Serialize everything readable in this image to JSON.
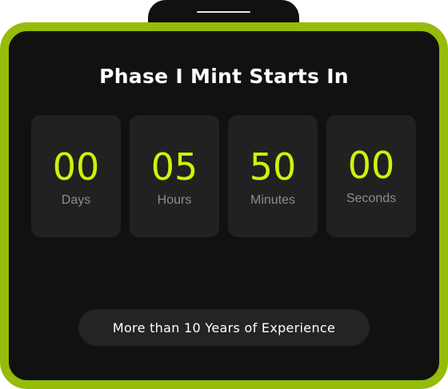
{
  "title": "Phase I Mint Starts In",
  "countdown": [
    {
      "value": "00",
      "label": "Days"
    },
    {
      "value": "05",
      "label": "Hours"
    },
    {
      "value": "50",
      "label": "Minutes"
    },
    {
      "value": "00",
      "label": "Seconds"
    }
  ],
  "experience_label": "More than 10 Years of Experience",
  "colors": {
    "accent": "#d0f20a",
    "frame": "#95bc0a",
    "background": "#111111",
    "tile": "#212121"
  }
}
